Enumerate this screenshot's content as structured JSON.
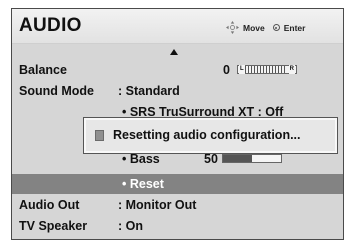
{
  "header": {
    "title": "AUDIO",
    "move_label": "Move",
    "enter_label": "Enter"
  },
  "menu": {
    "balance": {
      "label": "Balance",
      "value": "0",
      "left_mark": "L",
      "right_mark": "R",
      "level": 0.5
    },
    "sound_mode": {
      "label": "Sound Mode",
      "value": ": Standard"
    },
    "srs": {
      "value": "• SRS TruSurround XT : Off"
    },
    "bass": {
      "value": "• Bass",
      "number": "50",
      "level": 0.5
    },
    "reset": {
      "value": "• Reset"
    },
    "audio_out": {
      "label": "Audio Out",
      "value": ": Monitor Out"
    },
    "tv_speaker": {
      "label": "TV Speaker",
      "value": ": On"
    }
  },
  "popup": {
    "message": "Resetting audio configuration..."
  }
}
